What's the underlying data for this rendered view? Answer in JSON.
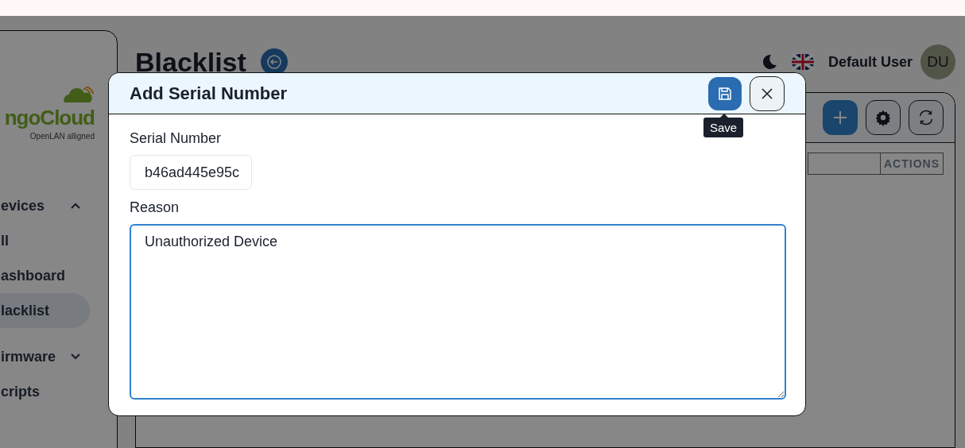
{
  "sidebar": {
    "logo": {
      "brand": "ngoCloud",
      "tagline": "OpenLAN alligned"
    },
    "items": [
      {
        "label": "evices",
        "kind": "group",
        "expanded": true,
        "selected": false
      },
      {
        "label": "ll",
        "kind": "link",
        "selected": false
      },
      {
        "label": "ashboard",
        "kind": "link",
        "selected": false
      },
      {
        "label": "lacklist",
        "kind": "link",
        "selected": true
      },
      {
        "label": "irmware",
        "kind": "group",
        "expanded": false,
        "selected": false
      },
      {
        "label": "cripts",
        "kind": "link",
        "selected": false
      }
    ]
  },
  "header": {
    "title": "Blacklist",
    "user": "Default User",
    "avatar": "DU"
  },
  "table": {
    "columns": [
      "ACTIONS"
    ]
  },
  "modal": {
    "title": "Add Serial Number",
    "save_tooltip": "Save",
    "fields": [
      {
        "label": "Serial Number",
        "value": "b46ad445e95c",
        "kind": "input"
      },
      {
        "label": "Reason",
        "value": "Unauthorized Device",
        "kind": "textarea"
      }
    ]
  }
}
